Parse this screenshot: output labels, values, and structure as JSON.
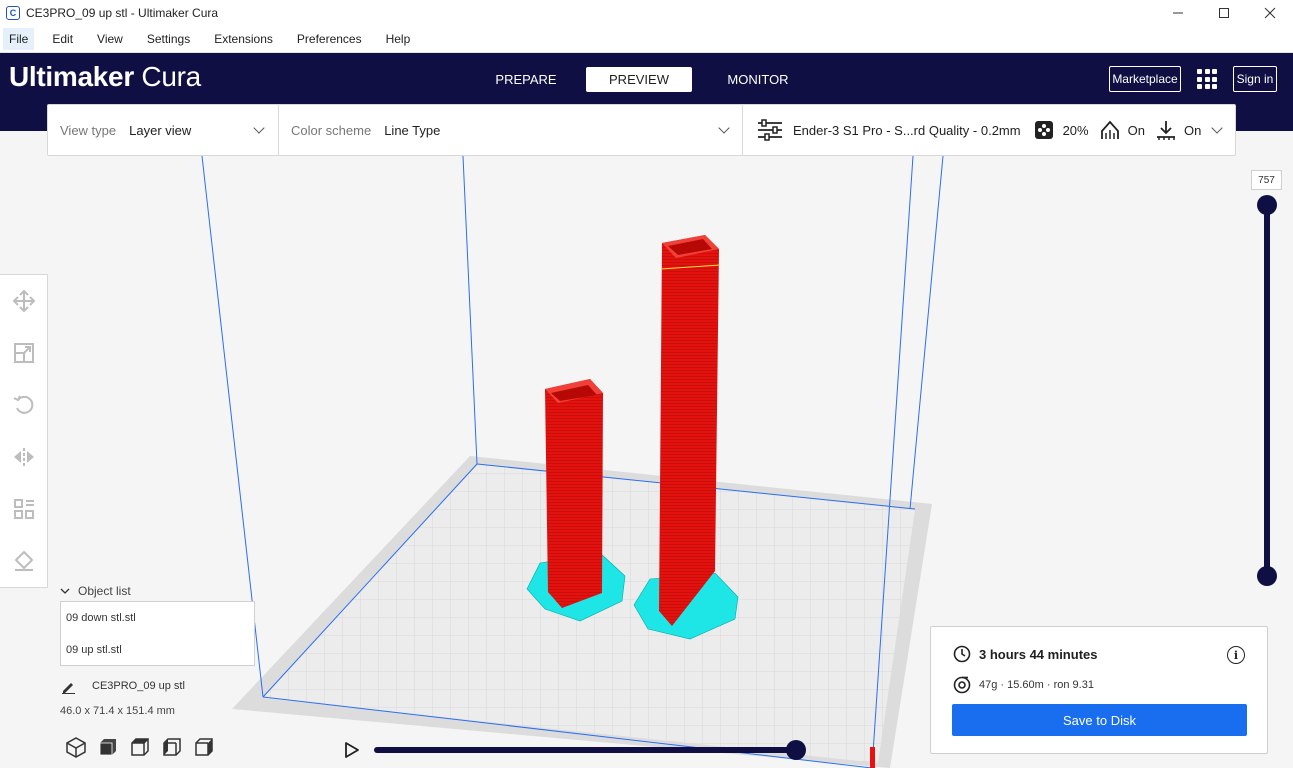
{
  "window": {
    "title": "CE3PRO_09 up stl - Ultimaker Cura",
    "minimize": "—",
    "maximize": "☐",
    "close": "✕"
  },
  "menu": {
    "items": [
      "File",
      "Edit",
      "View",
      "Settings",
      "Extensions",
      "Preferences",
      "Help"
    ]
  },
  "header": {
    "brand_bold": "Ultimaker",
    "brand_light": "Cura",
    "tabs": [
      "PREPARE",
      "PREVIEW",
      "MONITOR"
    ],
    "active_tab": "PREVIEW",
    "marketplace": "Marketplace",
    "sign_in": "Sign in"
  },
  "toolbar": {
    "view_type_label": "View type",
    "view_type_value": "Layer view",
    "color_scheme_label": "Color scheme",
    "color_scheme_value": "Line Type",
    "printer_profile": "Ender-3 S1 Pro - S...rd Quality - 0.2mm",
    "infill": "20%",
    "support": "On",
    "adhesion": "On"
  },
  "tools": [
    "move-icon",
    "scale-icon",
    "rotate-icon",
    "mirror-icon",
    "per-model-settings-icon",
    "support-blocker-icon"
  ],
  "object_list": {
    "header": "Object list",
    "items": [
      "09 down stl.stl",
      "09 up stl.stl"
    ],
    "current_name": "CE3PRO_09 up stl",
    "dimensions": "46.0 x 71.4 x 151.4 mm"
  },
  "layer_slider": {
    "max_layer": "757",
    "top_value": 1.0
  },
  "playback": {
    "progress": 1.0
  },
  "output": {
    "print_time": "3 hours 44 minutes",
    "material": "47g · 15.60m · ron 9.31",
    "save_button": "Save to Disk"
  },
  "colors": {
    "header_bg": "#0f0f44",
    "accent": "#196ef0",
    "model": "#e8110f",
    "skirt": "#1ee6e6"
  }
}
